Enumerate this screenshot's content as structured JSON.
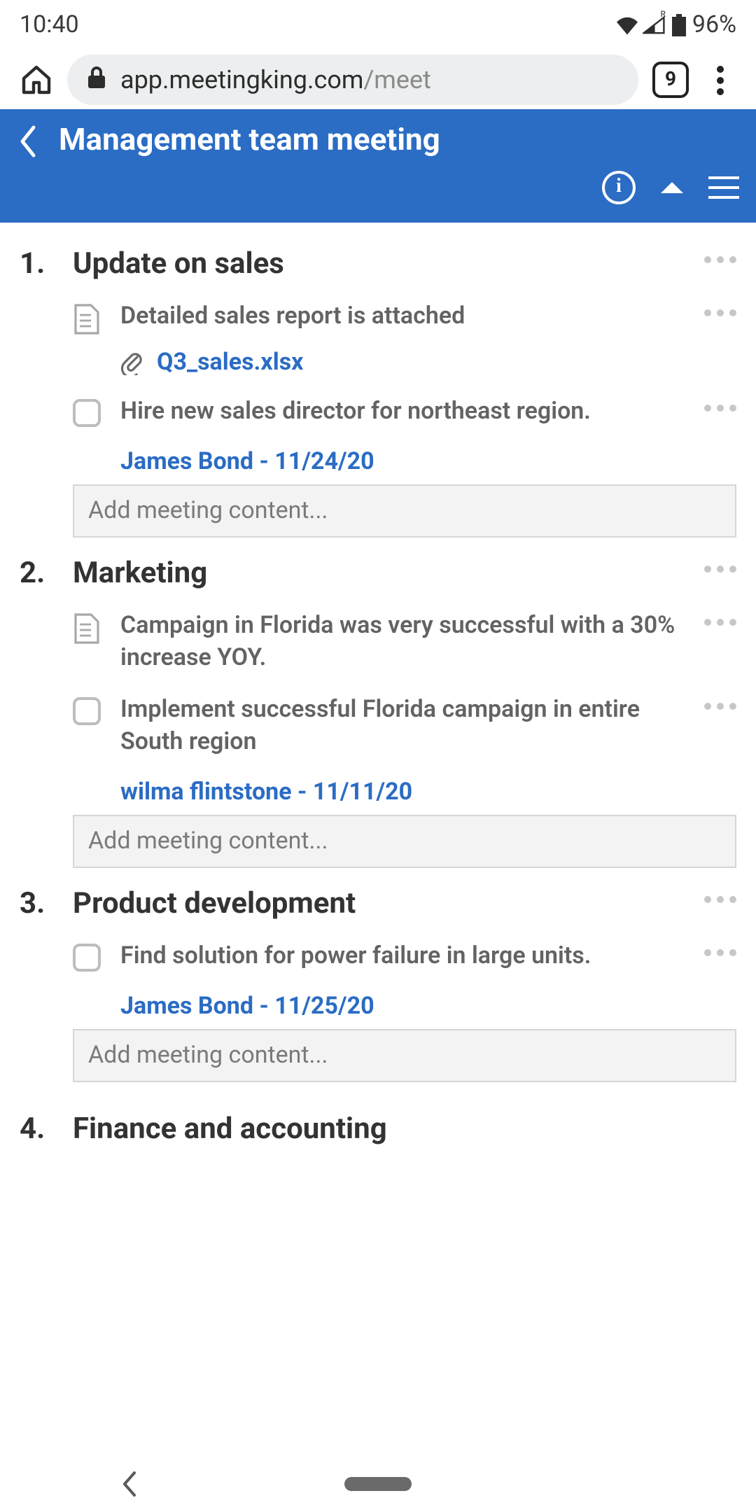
{
  "status": {
    "time": "10:40",
    "battery": "96%"
  },
  "browser": {
    "url_host": "app.meetingking.com",
    "url_path": "/meet",
    "tab_count": "9"
  },
  "header": {
    "title": "Management team meeting"
  },
  "topics": [
    {
      "num": "1.",
      "title": "Update on sales",
      "items": [
        {
          "type": "note",
          "text": "Detailed sales report is attached",
          "attachment": "Q3_sales.xlsx"
        },
        {
          "type": "task",
          "text": "Hire new sales director for northeast region.",
          "assignee": "James Bond - 11/24/20"
        }
      ],
      "add_placeholder": "Add meeting content..."
    },
    {
      "num": "2.",
      "title": "Marketing",
      "items": [
        {
          "type": "note",
          "text": "Campaign in Florida was very successful with a 30% increase YOY."
        },
        {
          "type": "task",
          "text": "Implement successful Florida campaign in entire South region",
          "assignee": "wilma flintstone - 11/11/20"
        }
      ],
      "add_placeholder": "Add meeting content..."
    },
    {
      "num": "3.",
      "title": "Product development",
      "items": [
        {
          "type": "task",
          "text": "Find solution for power failure in large units.",
          "assignee": "James Bond - 11/25/20"
        }
      ],
      "add_placeholder": "Add meeting content..."
    },
    {
      "num": "4.",
      "title": "Finance and accounting"
    }
  ]
}
